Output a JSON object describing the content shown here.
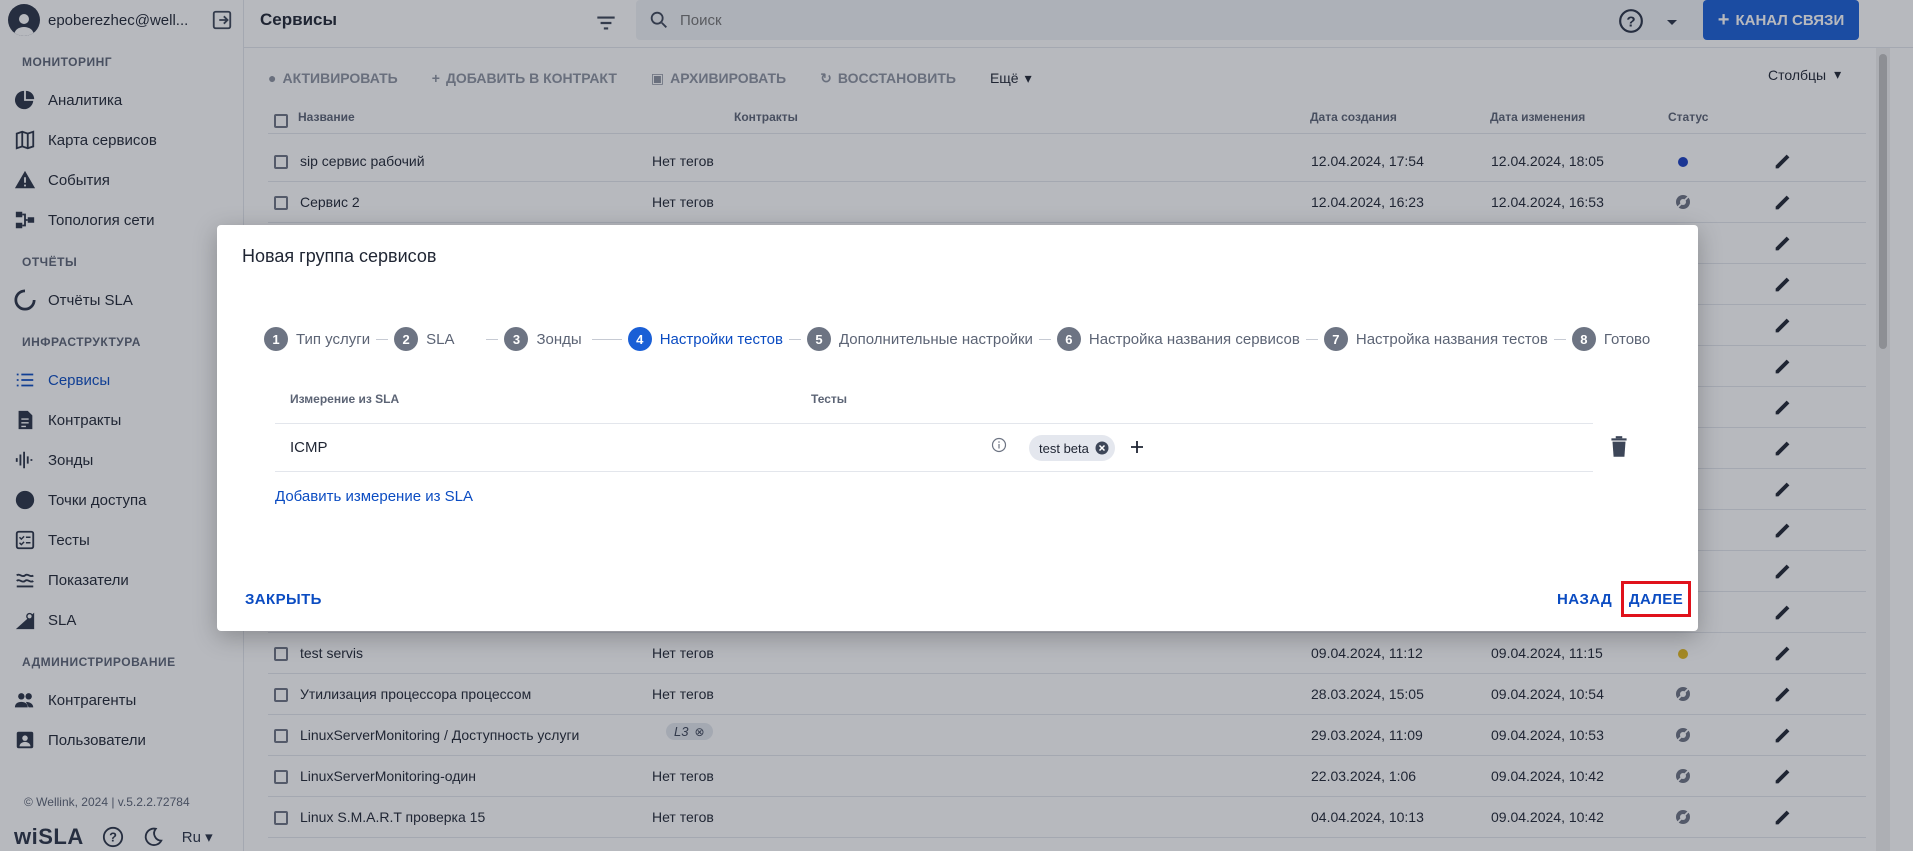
{
  "user": {
    "name": "epoberezhec@well..."
  },
  "sidebar": {
    "sections": [
      {
        "title": "МОНИТОРИНГ",
        "items": [
          {
            "label": "Аналитика",
            "icon": "pie-chart-icon"
          },
          {
            "label": "Карта сервисов",
            "icon": "map-icon"
          },
          {
            "label": "События",
            "icon": "warning-icon"
          },
          {
            "label": "Топология сети",
            "icon": "topology-icon"
          }
        ]
      },
      {
        "title": "ОТЧЁТЫ",
        "items": [
          {
            "label": "Отчёты SLA",
            "icon": "report-icon"
          }
        ]
      },
      {
        "title": "ИНФРАСТРУКТУРА",
        "items": [
          {
            "label": "Сервисы",
            "icon": "list-icon"
          },
          {
            "label": "Контракты",
            "icon": "document-icon"
          },
          {
            "label": "Зонды",
            "icon": "probe-icon"
          },
          {
            "label": "Точки доступа",
            "icon": "circle-icon"
          },
          {
            "label": "Тесты",
            "icon": "checklist-icon"
          },
          {
            "label": "Показатели",
            "icon": "metrics-icon"
          },
          {
            "label": "SLA",
            "icon": "sla-icon"
          }
        ]
      },
      {
        "title": "АДМИНИСТРИРОВАНИЕ",
        "items": [
          {
            "label": "Контрагенты",
            "icon": "people-icon"
          },
          {
            "label": "Пользователи",
            "icon": "user-card-icon"
          }
        ]
      }
    ],
    "active_item": "Сервисы",
    "copyright": "© Wellink, 2024 | v.5.2.2.72784",
    "logo": "wiSLA",
    "language": "Ru"
  },
  "topbar": {
    "title": "Сервисы",
    "search_placeholder": "Поиск",
    "channel_button": "КАНАЛ СВЯЗИ"
  },
  "toolbar": {
    "activate": "АКТИВИРОВАТЬ",
    "add_to_contract": "ДОБАВИТЬ В КОНТРАКТ",
    "archive": "АРХИВИРОВАТЬ",
    "restore": "ВОССТАНОВИТЬ",
    "more": "Ещё",
    "columns": "Столбцы"
  },
  "table": {
    "headers": {
      "name": "Название",
      "contracts": "Контракты",
      "created": "Дата создания",
      "modified": "Дата изменения",
      "status": "Статус"
    },
    "rows_top": [
      {
        "name": "sip сервис рабочий",
        "tags": "Нет тегов",
        "created": "12.04.2024, 17:54",
        "modified": "12.04.2024, 18:05",
        "status": "active"
      },
      {
        "name": "Сервис 2",
        "tags": "Нет тегов",
        "created": "12.04.2024, 16:23",
        "modified": "12.04.2024, 16:53",
        "status": "off"
      }
    ],
    "rows_bottom": [
      {
        "name": "test servis",
        "tags": "Нет тегов",
        "created": "09.04.2024, 11:12",
        "modified": "09.04.2024, 11:15",
        "status": "warning"
      },
      {
        "name": "Утилизация процессора процессом",
        "tags": "Нет тегов",
        "created": "28.03.2024, 15:05",
        "modified": "09.04.2024, 10:54",
        "status": "off"
      },
      {
        "name": "LinuxServerMonitoring / Доступность услуги",
        "tags": "L3",
        "created": "29.03.2024, 11:09",
        "modified": "09.04.2024, 10:53",
        "status": "off"
      },
      {
        "name": "LinuxServerMonitoring-один",
        "tags": "Нет тегов",
        "created": "22.03.2024, 1:06",
        "modified": "09.04.2024, 10:42",
        "status": "off"
      },
      {
        "name": "Linux S.M.A.R.T проверка 15",
        "tags": "Нет тегов",
        "created": "04.04.2024, 10:13",
        "modified": "09.04.2024, 10:42",
        "status": "off"
      }
    ]
  },
  "modal": {
    "title": "Новая группа сервисов",
    "steps": [
      {
        "num": "1",
        "label": "Тип услуги"
      },
      {
        "num": "2",
        "label": "SLA"
      },
      {
        "num": "3",
        "label": "Зонды"
      },
      {
        "num": "4",
        "label": "Настройки тестов"
      },
      {
        "num": "5",
        "label": "Дополнительные настройки"
      },
      {
        "num": "6",
        "label": "Настройка названия сервисов"
      },
      {
        "num": "7",
        "label": "Настройка названия тестов"
      },
      {
        "num": "8",
        "label": "Готово"
      }
    ],
    "active_step": "4",
    "col_metric": "Измерение из SLA",
    "col_tests": "Тесты",
    "metric": "ICMP",
    "test_chip": "test beta",
    "add_metric": "Добавить измерение из SLA",
    "close": "ЗАКРЫТЬ",
    "back": "НАЗАД",
    "next": "ДАЛЕЕ"
  },
  "colors": {
    "accent": "#1a5fd6",
    "link": "#0b4cc2",
    "highlight": "#e0121b",
    "status_active": "#1a3fc2",
    "status_warning": "#e3b81c"
  }
}
